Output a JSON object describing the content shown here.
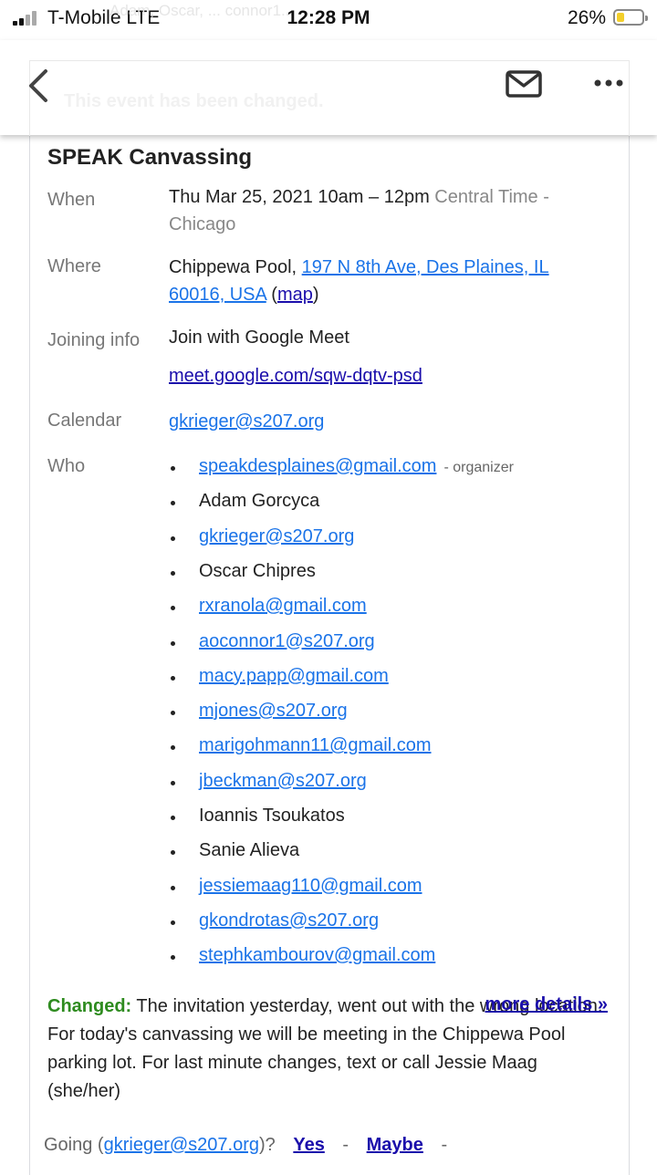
{
  "status_bar": {
    "carrier": "T-Mobile  LTE",
    "time": "12:28 PM",
    "battery_percent": "26%",
    "battery_level": 0.26,
    "behind_text": "Adam, Oscar, ... connor1..."
  },
  "toolbar": {
    "back_icon": "chevron-left-icon",
    "mail_icon": "envelope-icon",
    "more_icon": "more-horizontal-icon",
    "hidden_banner": "This event has been changed."
  },
  "event": {
    "title": "SPEAK Canvassing",
    "when_label": "When",
    "when_value": "Thu Mar 25, 2021 10am – 12pm",
    "when_tz": "Central Time - Chicago",
    "where_label": "Where",
    "where_place": "Chippewa Pool,",
    "where_address": "197 N 8th Ave, Des Plaines, IL 60016, USA",
    "map_link": "map",
    "joining_label": "Joining info",
    "joining_text": "Join with Google Meet",
    "meet_link": "meet.google.com/sqw-dqtv-psd",
    "calendar_label": "Calendar",
    "calendar_value": "gkrieger@s207.org",
    "who_label": "Who",
    "organizer_suffix": "- organizer"
  },
  "attendees": [
    {
      "name": "speakdesplaines@gmail.com",
      "link": true
    },
    {
      "name": "Adam Gorcyca",
      "link": false
    },
    {
      "name": "gkrieger@s207.org",
      "link": true
    },
    {
      "name": "Oscar Chipres",
      "link": false
    },
    {
      "name": "rxranola@gmail.com",
      "link": true
    },
    {
      "name": "aoconnor1@s207.org",
      "link": true
    },
    {
      "name": "macy.papp@gmail.com",
      "link": true
    },
    {
      "name": "mjones@s207.org",
      "link": true
    },
    {
      "name": "marigohmann11@gmail.com",
      "link": true
    },
    {
      "name": "jbeckman@s207.org",
      "link": true
    },
    {
      "name": "Ioannis Tsoukatos",
      "link": false
    },
    {
      "name": "Sanie Alieva",
      "link": false
    },
    {
      "name": "jessiemaag110@gmail.com",
      "link": true
    },
    {
      "name": "gkondrotas@s207.org",
      "link": true
    },
    {
      "name": "stephkambourov@gmail.com",
      "link": true
    }
  ],
  "changed": {
    "tag": "Changed:",
    "text": "The invitation yesterday, went out with the wrong location. For today's canvassing we will be meeting in the Chippewa Pool parking lot. For last minute changes, text or call Jessie Maag (she/her)",
    "more_details": "more details »"
  },
  "rsvp": {
    "going_prefix": "Going (",
    "email": "gkrieger@s207.org",
    "going_suffix": ")?",
    "yes": "Yes",
    "dash": "-",
    "maybe": "Maybe",
    "trailing": "-"
  }
}
